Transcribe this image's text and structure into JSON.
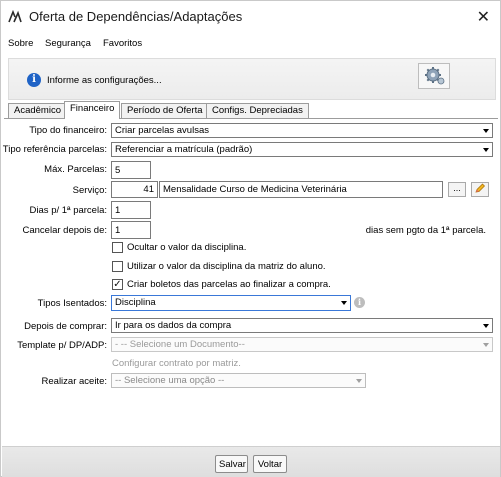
{
  "window": {
    "title": "Oferta de Dependências/Adaptações",
    "close_symbol": "✕"
  },
  "menu": {
    "items": [
      "Sobre",
      "Segurança",
      "Favoritos"
    ]
  },
  "info": {
    "text": "Informe as configurações..."
  },
  "tabs": [
    "Acadêmico",
    "Financeiro",
    "Período de Oferta",
    "Configs. Depreciadas"
  ],
  "form": {
    "tipo_financeiro": {
      "label": "Tipo do financeiro:",
      "value": "Criar parcelas avulsas"
    },
    "tipo_referencia": {
      "label": "Tipo referência parcelas:",
      "value": "Referenciar a matrícula (padrão)"
    },
    "max_parcelas": {
      "label": "Máx. Parcelas:",
      "value": "5"
    },
    "servico": {
      "label": "Serviço:",
      "code": "41",
      "description": "Mensalidade Curso de Medicina Veterinária",
      "search_label": "..."
    },
    "dias_primeira": {
      "label": "Dias p/ 1ª parcela:",
      "value": "1"
    },
    "cancelar": {
      "label": "Cancelar depois de:",
      "value": "1",
      "suffix": "dias sem pgto da 1ª parcela."
    },
    "checkboxes": [
      {
        "label": "Ocultar o valor da disciplina.",
        "checked": false
      },
      {
        "label": "Utilizar o valor da disciplina da matriz do aluno.",
        "checked": false
      },
      {
        "label": "Criar boletos das parcelas ao finalizar a compra.",
        "checked": true
      }
    ],
    "tipos_isentados": {
      "label": "Tipos Isentados:",
      "value": "Disciplina"
    },
    "depois_comprar": {
      "label": "Depois de comprar:",
      "value": "Ir para os dados da compra"
    },
    "template": {
      "label": "Template p/ DP/ADP:",
      "value": "- -- Selecione um Documento--",
      "hint": "Configurar contrato por matriz."
    },
    "realizar_aceite": {
      "label": "Realizar aceite:",
      "value": "-- Selecione uma opção --"
    }
  },
  "buttons": {
    "save": "Salvar",
    "back": "Voltar"
  }
}
